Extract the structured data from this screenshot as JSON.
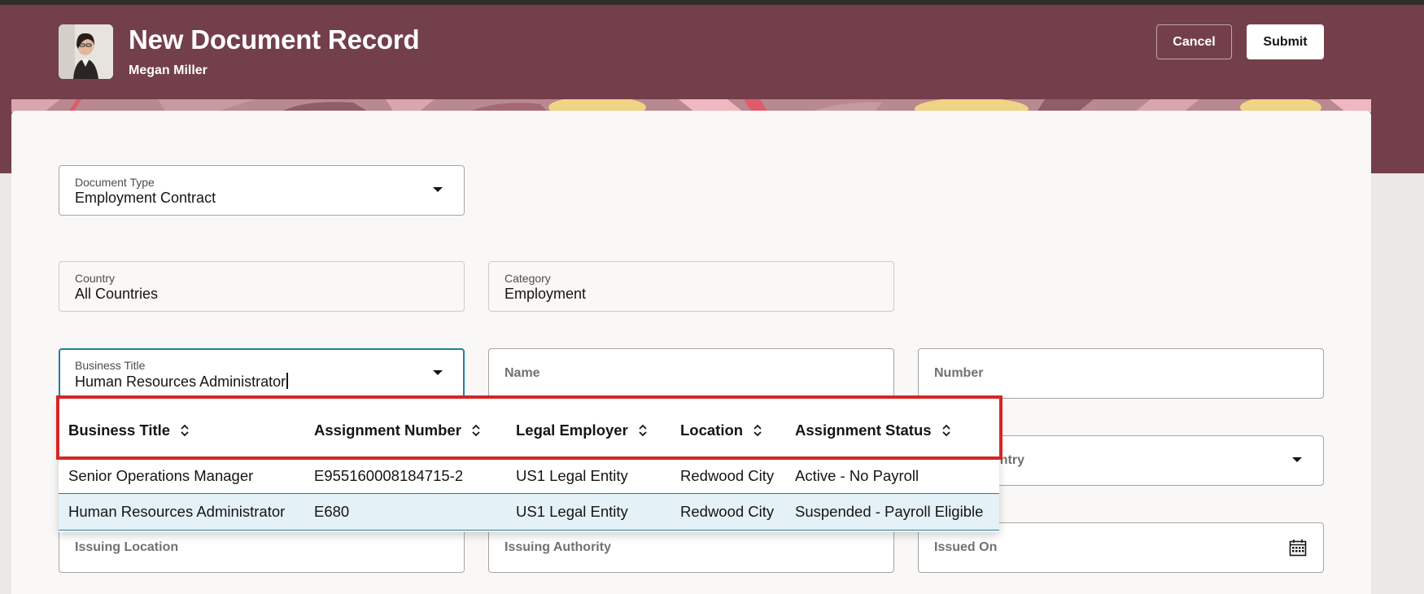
{
  "header": {
    "title": "New Document Record",
    "subtitle": "Megan Miller",
    "cancel_label": "Cancel",
    "submit_label": "Submit",
    "background_color": "#733f4a"
  },
  "form": {
    "document_type": {
      "label": "Document Type",
      "value": "Employment Contract"
    },
    "country": {
      "label": "Country",
      "value": "All Countries"
    },
    "category": {
      "label": "Category",
      "value": "Employment"
    },
    "business_title": {
      "label": "Business Title",
      "value": "Human Resources Administrator"
    },
    "name": {
      "placeholder": "Name"
    },
    "number": {
      "placeholder": "Number"
    },
    "issuing_country": {
      "placeholder": "untry"
    },
    "issuing_location": {
      "placeholder": "Issuing Location"
    },
    "issuing_authority": {
      "placeholder": "Issuing Authority"
    },
    "issued_on": {
      "placeholder": "Issued On"
    }
  },
  "dropdown": {
    "columns": [
      "Business Title",
      "Assignment Number",
      "Legal Employer",
      "Location",
      "Assignment Status"
    ],
    "rows": [
      {
        "business_title": "Senior Operations Manager",
        "assignment_number": "E955160008184715-2",
        "legal_employer": "US1 Legal Entity",
        "location": "Redwood City",
        "assignment_status": "Active - No Payroll",
        "selected": false
      },
      {
        "business_title": "Human Resources Administrator",
        "assignment_number": "E680",
        "legal_employer": "US1 Legal Entity",
        "location": "Redwood City",
        "assignment_status": "Suspended - Payroll Eligible",
        "selected": true
      }
    ]
  },
  "colors": {
    "focus": "#227e9e",
    "highlight": "#d32626",
    "selected_row": "#e4f1f7"
  }
}
